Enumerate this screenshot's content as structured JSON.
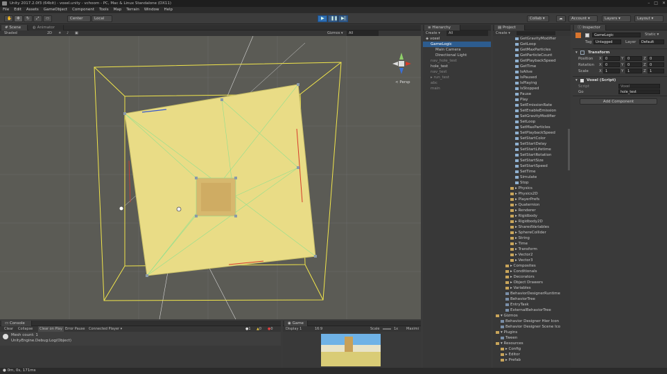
{
  "titlebar": {
    "title": "Unity 2017.2.0f3 (64bit) - voxel.unity - vchoom - PC, Mac & Linux Standalone (DX11)",
    "controls": [
      "–",
      "□",
      "✕"
    ]
  },
  "menu": [
    "File",
    "Edit",
    "Assets",
    "GameObject",
    "Component",
    "Tools",
    "Map",
    "Terrain",
    "Window",
    "Help"
  ],
  "toolbar": {
    "center_label": "Center",
    "local_label": "Local",
    "collab_label": "Collab ▾",
    "account_label": "Account ▾",
    "layers_label": "Layers ▾",
    "layout_label": "Layout ▾"
  },
  "scene": {
    "tabs": [
      "Scene",
      "Animator"
    ],
    "shading": "Shaded",
    "mode_2d": "2D",
    "gizmos": "Gizmos ▾",
    "search_all": "All",
    "persp_label": "< Persp"
  },
  "hierarchy": {
    "tab": "Hierarchy",
    "create": "Create ▾",
    "search": "All",
    "scene_name": "voxel",
    "items": [
      {
        "label": "GameLogic",
        "indent": 1,
        "selected": true,
        "dim": false
      },
      {
        "label": "Main Camera",
        "indent": 2,
        "selected": false,
        "dim": false
      },
      {
        "label": "Directional Light",
        "indent": 2,
        "selected": false,
        "dim": false
      },
      {
        "label": "nav_hole_test",
        "indent": 1,
        "selected": false,
        "dim": true
      },
      {
        "label": "hole_test",
        "indent": 1,
        "selected": false,
        "dim": false
      },
      {
        "label": "nav_test",
        "indent": 1,
        "selected": false,
        "dim": true
      },
      {
        "label": "▸ run_test",
        "indent": 1,
        "selected": false,
        "dim": true
      },
      {
        "label": "abc",
        "indent": 1,
        "selected": false,
        "dim": true
      },
      {
        "label": "main",
        "indent": 1,
        "selected": false,
        "dim": true
      }
    ]
  },
  "project": {
    "tab": "Project",
    "create": "Create ▾",
    "items": [
      {
        "label": "GetGravityModifier",
        "indent": 4,
        "kind": "script"
      },
      {
        "label": "GetLoop",
        "indent": 4,
        "kind": "script"
      },
      {
        "label": "GetMaxParticles",
        "indent": 4,
        "kind": "script"
      },
      {
        "label": "GetParticleCount",
        "indent": 4,
        "kind": "script"
      },
      {
        "label": "GetPlaybackSpeed",
        "indent": 4,
        "kind": "script"
      },
      {
        "label": "GetTime",
        "indent": 4,
        "kind": "script"
      },
      {
        "label": "IsAlive",
        "indent": 4,
        "kind": "script"
      },
      {
        "label": "IsPaused",
        "indent": 4,
        "kind": "script"
      },
      {
        "label": "IsPlaying",
        "indent": 4,
        "kind": "script"
      },
      {
        "label": "IsStopped",
        "indent": 4,
        "kind": "script"
      },
      {
        "label": "Pause",
        "indent": 4,
        "kind": "script"
      },
      {
        "label": "Play",
        "indent": 4,
        "kind": "script"
      },
      {
        "label": "SetEmissionRate",
        "indent": 4,
        "kind": "script"
      },
      {
        "label": "SetEnableEmission",
        "indent": 4,
        "kind": "script"
      },
      {
        "label": "SetGravityModifier",
        "indent": 4,
        "kind": "script"
      },
      {
        "label": "SetLoop",
        "indent": 4,
        "kind": "script"
      },
      {
        "label": "SetMaxParticles",
        "indent": 4,
        "kind": "script"
      },
      {
        "label": "SetPlaybackSpeed",
        "indent": 4,
        "kind": "script"
      },
      {
        "label": "SetStartColor",
        "indent": 4,
        "kind": "script"
      },
      {
        "label": "SetStartDelay",
        "indent": 4,
        "kind": "script"
      },
      {
        "label": "SetStartLifetime",
        "indent": 4,
        "kind": "script"
      },
      {
        "label": "SetStartRotation",
        "indent": 4,
        "kind": "script"
      },
      {
        "label": "SetStartSize",
        "indent": 4,
        "kind": "script"
      },
      {
        "label": "SetStartSpeed",
        "indent": 4,
        "kind": "script"
      },
      {
        "label": "SetTime",
        "indent": 4,
        "kind": "script"
      },
      {
        "label": "Simulate",
        "indent": 4,
        "kind": "script"
      },
      {
        "label": "Stop",
        "indent": 4,
        "kind": "script"
      },
      {
        "label": "▸ Physics",
        "indent": 3,
        "kind": "folder"
      },
      {
        "label": "▸ Physics2D",
        "indent": 3,
        "kind": "folder"
      },
      {
        "label": "▸ PlayerPrefs",
        "indent": 3,
        "kind": "folder"
      },
      {
        "label": "▸ Quaternion",
        "indent": 3,
        "kind": "folder"
      },
      {
        "label": "▸ Renderer",
        "indent": 3,
        "kind": "folder"
      },
      {
        "label": "▸ Rigidbody",
        "indent": 3,
        "kind": "folder"
      },
      {
        "label": "▸ Rigidbody2D",
        "indent": 3,
        "kind": "folder"
      },
      {
        "label": "▸ SharedVariables",
        "indent": 3,
        "kind": "folder"
      },
      {
        "label": "▸ SphereCollider",
        "indent": 3,
        "kind": "folder"
      },
      {
        "label": "▸ String",
        "indent": 3,
        "kind": "folder"
      },
      {
        "label": "▸ Time",
        "indent": 3,
        "kind": "folder"
      },
      {
        "label": "▸ Transform",
        "indent": 3,
        "kind": "folder"
      },
      {
        "label": "▸ Vector2",
        "indent": 3,
        "kind": "folder"
      },
      {
        "label": "▸ Vector3",
        "indent": 3,
        "kind": "folder"
      },
      {
        "label": "▸ Composites",
        "indent": 2,
        "kind": "folder"
      },
      {
        "label": "▸ Conditionals",
        "indent": 2,
        "kind": "folder"
      },
      {
        "label": "▸ Decorators",
        "indent": 2,
        "kind": "folder"
      },
      {
        "label": "▸ Object Drawers",
        "indent": 2,
        "kind": "folder"
      },
      {
        "label": "▸ Variables",
        "indent": 2,
        "kind": "folder"
      },
      {
        "label": "BehaviorDesignerRuntime",
        "indent": 2,
        "kind": "file"
      },
      {
        "label": "BehaviorTree",
        "indent": 2,
        "kind": "file"
      },
      {
        "label": "EntryTask",
        "indent": 2,
        "kind": "file"
      },
      {
        "label": "ExternalBehaviorTree",
        "indent": 2,
        "kind": "file"
      },
      {
        "label": "▾ Gizmos",
        "indent": 0,
        "kind": "folder"
      },
      {
        "label": "Behavior Designer Hier Icon",
        "indent": 1,
        "kind": "file"
      },
      {
        "label": "Behavior Designer Scene Ico",
        "indent": 1,
        "kind": "file"
      },
      {
        "label": "▾ Plugins",
        "indent": 0,
        "kind": "folder"
      },
      {
        "label": "Tween",
        "indent": 1,
        "kind": "file"
      },
      {
        "label": "▾ Resources",
        "indent": 0,
        "kind": "folder"
      },
      {
        "label": "▸ Config",
        "indent": 1,
        "kind": "folder"
      },
      {
        "label": "▸ Editor",
        "indent": 1,
        "kind": "folder"
      },
      {
        "label": "▸ Prefab",
        "indent": 1,
        "kind": "folder"
      }
    ]
  },
  "inspector": {
    "tab": "Inspector",
    "object_name": "GameLogic",
    "static_label": "Static ▾",
    "tag_label": "Tag",
    "tag_value": "Untagged",
    "layer_label": "Layer",
    "layer_value": "Default",
    "transform_title": "Transform",
    "position_label": "Position",
    "rotation_label": "Rotation",
    "scale_label": "Scale",
    "position": [
      "0",
      "0",
      "0"
    ],
    "rotation": [
      "0",
      "0",
      "0"
    ],
    "scale": [
      "1",
      "1",
      "1"
    ],
    "axis": [
      "X",
      "Y",
      "Z"
    ],
    "script_title": "Voxel (Script)",
    "script_field_label": "Script",
    "script_field_value": "Voxel",
    "go_label": "Go",
    "go_value": "hole_test",
    "add_component": "Add Component"
  },
  "console": {
    "tab": "Console",
    "buttons": [
      "Clear",
      "Collapse",
      "Clear on Play",
      "Error Pause",
      "Connected Player ▾"
    ],
    "counts": [
      "1",
      "0",
      "0"
    ],
    "log_line1": "Mesh count: 1",
    "log_line2": "UnityEngine.Debug:Log(Object)"
  },
  "game": {
    "tab": "Game",
    "display": "Display 1",
    "aspect": "16:9",
    "scale": "Scale",
    "scale_value": "1x",
    "maximize": "Maximi"
  },
  "status": {
    "text": "0m, 0s, 171ms"
  },
  "colors": {
    "accent": "#2d5c8f",
    "mesh_fill": "#e9dc86",
    "selection_yellow": "#f2e64b"
  }
}
